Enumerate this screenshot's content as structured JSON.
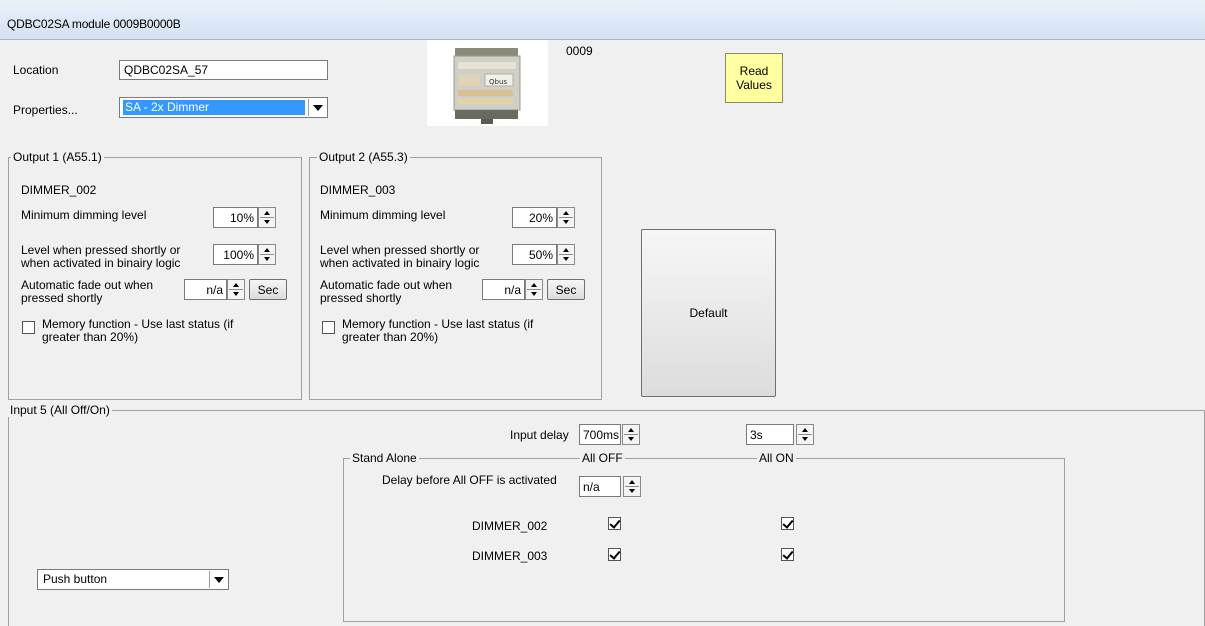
{
  "window": {
    "title": "QDBC02SA module 0009B0000B"
  },
  "header": {
    "location_label": "Location",
    "location_value": "QDBC02SA_57",
    "properties_label": "Properties...",
    "properties_value": "SA - 2x Dimmer",
    "module_code": "0009",
    "device_brand": "Qbus",
    "read_values_label": "Read\nValues",
    "default_label": "Default"
  },
  "output1": {
    "title": "Output 1 (A55.1)",
    "name": "DIMMER_002",
    "min_level_label": "Minimum dimming level",
    "min_level_value": "10%",
    "level_pressed_label": "Level when pressed shortly or when activated in binairy logic",
    "level_pressed_value": "100%",
    "fade_label": "Automatic fade out when pressed shortly",
    "fade_value": "n/a",
    "fade_unit": "Sec",
    "memory_label": "Memory function - Use last status (if greater than 20%)",
    "memory_checked": false
  },
  "output2": {
    "title": "Output 2 (A55.3)",
    "name": "DIMMER_003",
    "min_level_label": "Minimum dimming level",
    "min_level_value": "20%",
    "level_pressed_label": "Level when pressed shortly or when activated in binairy logic",
    "level_pressed_value": "50%",
    "fade_label": "Automatic fade out when pressed shortly",
    "fade_value": "n/a",
    "fade_unit": "Sec",
    "memory_label": "Memory function - Use last status (if greater than 20%)",
    "memory_checked": false
  },
  "input5": {
    "title": "Input 5 (All Off/On)",
    "input_delay_label": "Input delay",
    "input_delay_value": "700ms",
    "second_delay_value": "3s",
    "mode_value": "Push button",
    "stand_alone": {
      "title": "Stand Alone",
      "col_off": "All OFF",
      "col_on": "All ON",
      "delay_label": "Delay before All OFF is activated",
      "delay_value": "n/a",
      "rows": [
        {
          "name": "DIMMER_002",
          "all_off": true,
          "all_on": true
        },
        {
          "name": "DIMMER_003",
          "all_off": true,
          "all_on": true
        }
      ]
    }
  },
  "colors": {
    "selection": "#3399ff",
    "read_button": "#ffffa0",
    "background": "#f0f0f0"
  }
}
